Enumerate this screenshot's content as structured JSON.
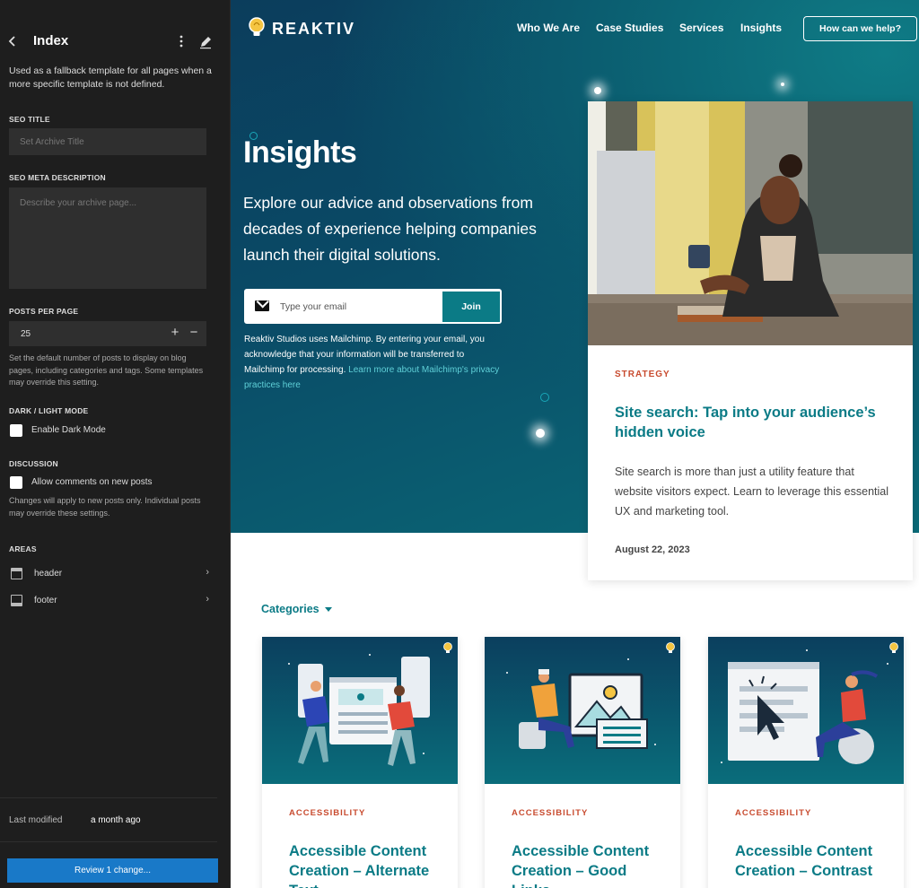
{
  "sidebar": {
    "title": "Index",
    "description": "Used as a fallback template for all pages when a more specific template is not defined.",
    "seo_title": {
      "label": "SEO TITLE",
      "placeholder": "Set Archive Title"
    },
    "seo_meta": {
      "label": "SEO META DESCRIPTION",
      "placeholder": "Describe your archive page..."
    },
    "posts_per_page": {
      "label": "POSTS PER PAGE",
      "value": "25",
      "help": "Set the default number of posts to display on blog pages, including categories and tags. Some templates may override this setting."
    },
    "dark_light": {
      "label": "DARK / LIGHT MODE",
      "checkbox_label": "Enable Dark Mode"
    },
    "discussion": {
      "label": "DISCUSSION",
      "checkbox_label": "Allow comments on new posts",
      "help": "Changes will apply to new posts only. Individual posts may override these settings."
    },
    "areas": {
      "label": "AREAS",
      "items": [
        {
          "label": "header"
        },
        {
          "label": "footer"
        }
      ]
    },
    "last_modified": {
      "label": "Last modified",
      "value": "a month ago"
    },
    "review_button": "Review 1 change..."
  },
  "site": {
    "logo_text": "REAKTIV",
    "nav": [
      "Who We Are",
      "Case Studies",
      "Services",
      "Insights"
    ],
    "help_button": "How can we help?",
    "hero_title": "Insights",
    "hero_subtitle": "Explore our advice and observations from decades of experience helping companies launch their digital solutions.",
    "email_placeholder": "Type your email",
    "join_button": "Join",
    "disclaimer_text": "Reaktiv Studios uses Mailchimp. By entering your email, you acknowledge that your information will be transferred to Mailchimp for processing.",
    "disclaimer_link": "Learn more about Mailchimp's privacy practices here",
    "feature": {
      "tag": "STRATEGY",
      "title": "Site search: Tap into your audience’s hidden voice",
      "text": "Site search is more than just a utility feature that website visitors expect. Learn to leverage this essential UX and marketing tool.",
      "date": "August 22, 2023"
    },
    "categories_label": "Categories",
    "cards": [
      {
        "tag": "ACCESSIBILITY",
        "title": "Accessible Content Creation – Alternate Text"
      },
      {
        "tag": "ACCESSIBILITY",
        "title": "Accessible Content Creation – Good Links"
      },
      {
        "tag": "ACCESSIBILITY",
        "title": "Accessible Content Creation – Contrast"
      }
    ]
  },
  "colors": {
    "sidebar_bg": "#1e1e1e",
    "review_button": "#1979c8",
    "brand_teal": "#0b7b86",
    "tag_red": "#c84b2f",
    "hero_dark": "#0b3d5c"
  }
}
